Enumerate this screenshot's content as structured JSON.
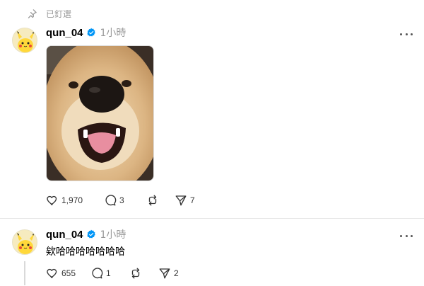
{
  "pinned": {
    "label": "已釘選",
    "icon": "pin-icon"
  },
  "posts": [
    {
      "username": "qun_04",
      "verified": true,
      "timestamp": "1小時",
      "text": "",
      "has_image": true,
      "image_subject": "dog",
      "actions": {
        "likes": "1,970",
        "replies": "3",
        "reposts": "",
        "shares": "7"
      }
    },
    {
      "username": "qun_04",
      "verified": true,
      "timestamp": "1小時",
      "text": "欸哈哈哈哈哈哈哈",
      "has_image": false,
      "actions": {
        "likes": "655",
        "replies": "1",
        "reposts": "",
        "shares": "2"
      }
    }
  ],
  "colors": {
    "verified": "#0095f6",
    "muted": "#999999",
    "divider": "#e5e5e5"
  }
}
